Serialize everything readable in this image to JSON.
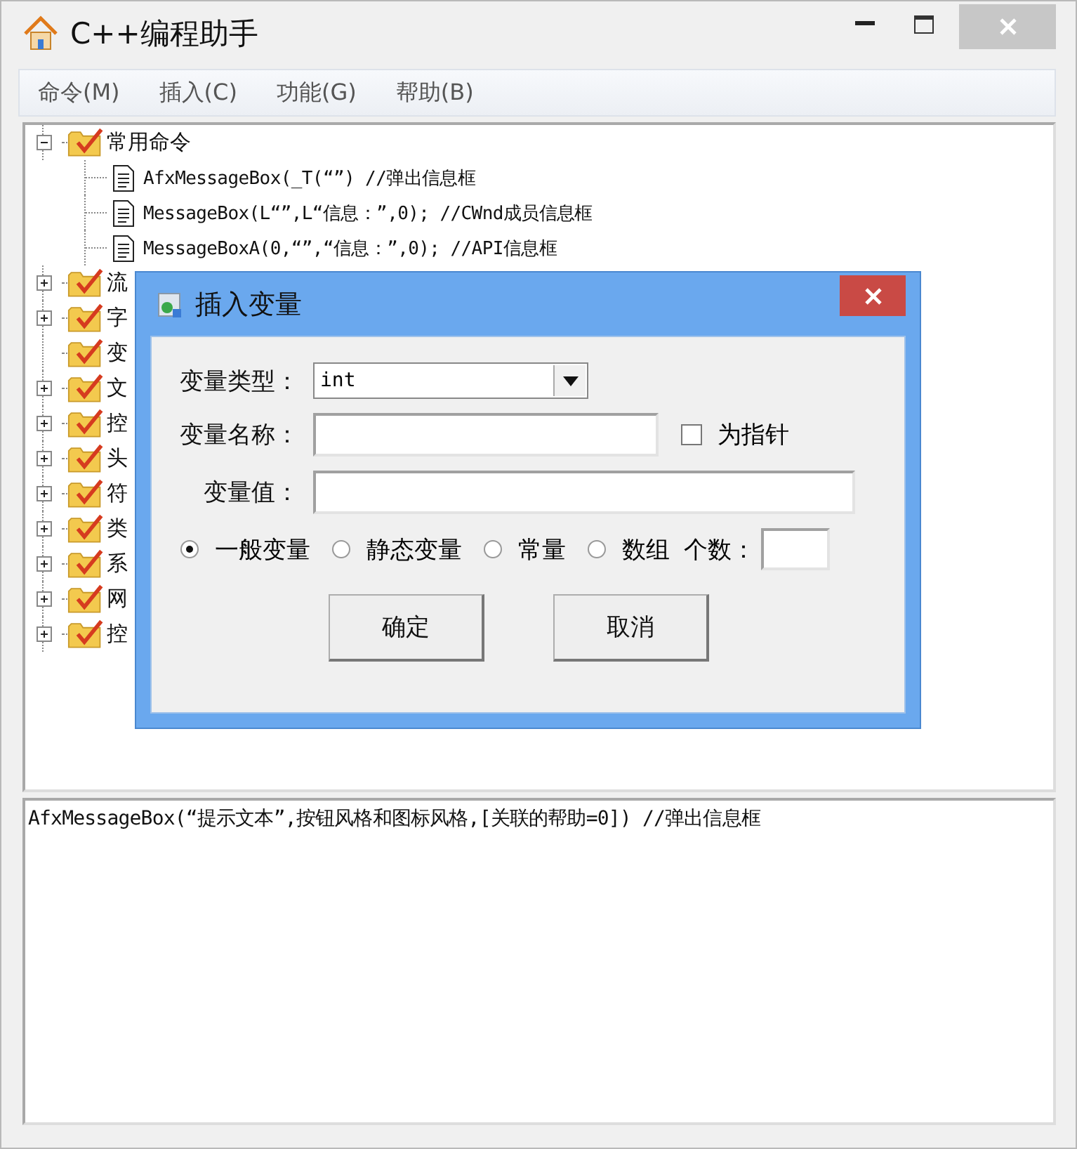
{
  "window": {
    "title": "C++编程助手"
  },
  "menu": [
    "命令(M)",
    "插入(C)",
    "功能(G)",
    "帮助(B)"
  ],
  "tree": [
    {
      "label": "常用命令",
      "kind": "collapsible",
      "expanded": true,
      "children": [
        {
          "label": "AfxMessageBox(_T(“”) //弹出信息框",
          "kind": "document"
        },
        {
          "label": "MessageBox(L“”,L“信息：”,0); //CWnd成员信息框",
          "kind": "document"
        },
        {
          "label": "MessageBoxA(0,“”,“信息：”,0); //API信息框",
          "kind": "document"
        }
      ]
    },
    {
      "label": "流",
      "kind": "collapsible",
      "expanded": false
    },
    {
      "label": "字",
      "kind": "collapsible",
      "expanded": false
    },
    {
      "label": "变",
      "kind": "plain"
    },
    {
      "label": "文",
      "kind": "collapsible",
      "expanded": false
    },
    {
      "label": "控",
      "kind": "collapsible",
      "expanded": false
    },
    {
      "label": "头",
      "kind": "collapsible",
      "expanded": false
    },
    {
      "label": "符",
      "kind": "collapsible",
      "expanded": false
    },
    {
      "label": "类",
      "kind": "collapsible",
      "expanded": false
    },
    {
      "label": "系",
      "kind": "collapsible",
      "expanded": false
    },
    {
      "label": "网",
      "kind": "collapsible",
      "expanded": false
    },
    {
      "label": "控",
      "kind": "collapsible",
      "expanded": false
    }
  ],
  "detail": {
    "text": "AfxMessageBox(“提示文本”,按钮风格和图标风格,[关联的帮助=0]) //弹出信息框"
  },
  "dialog": {
    "title": "插入变量",
    "type": {
      "label": "变量类型：",
      "value": "int"
    },
    "name": {
      "label": "变量名称："
    },
    "pointer": {
      "label": "为指针",
      "checked": false
    },
    "value": {
      "label": "变量值："
    },
    "options": [
      {
        "label": "一般变量",
        "selected": true
      },
      {
        "label": "静态变量",
        "selected": false
      },
      {
        "label": "常量",
        "selected": false
      },
      {
        "label": "数组",
        "selected": false
      }
    ],
    "count": {
      "label": "个数："
    },
    "buttons": [
      "确定",
      "取消"
    ]
  }
}
